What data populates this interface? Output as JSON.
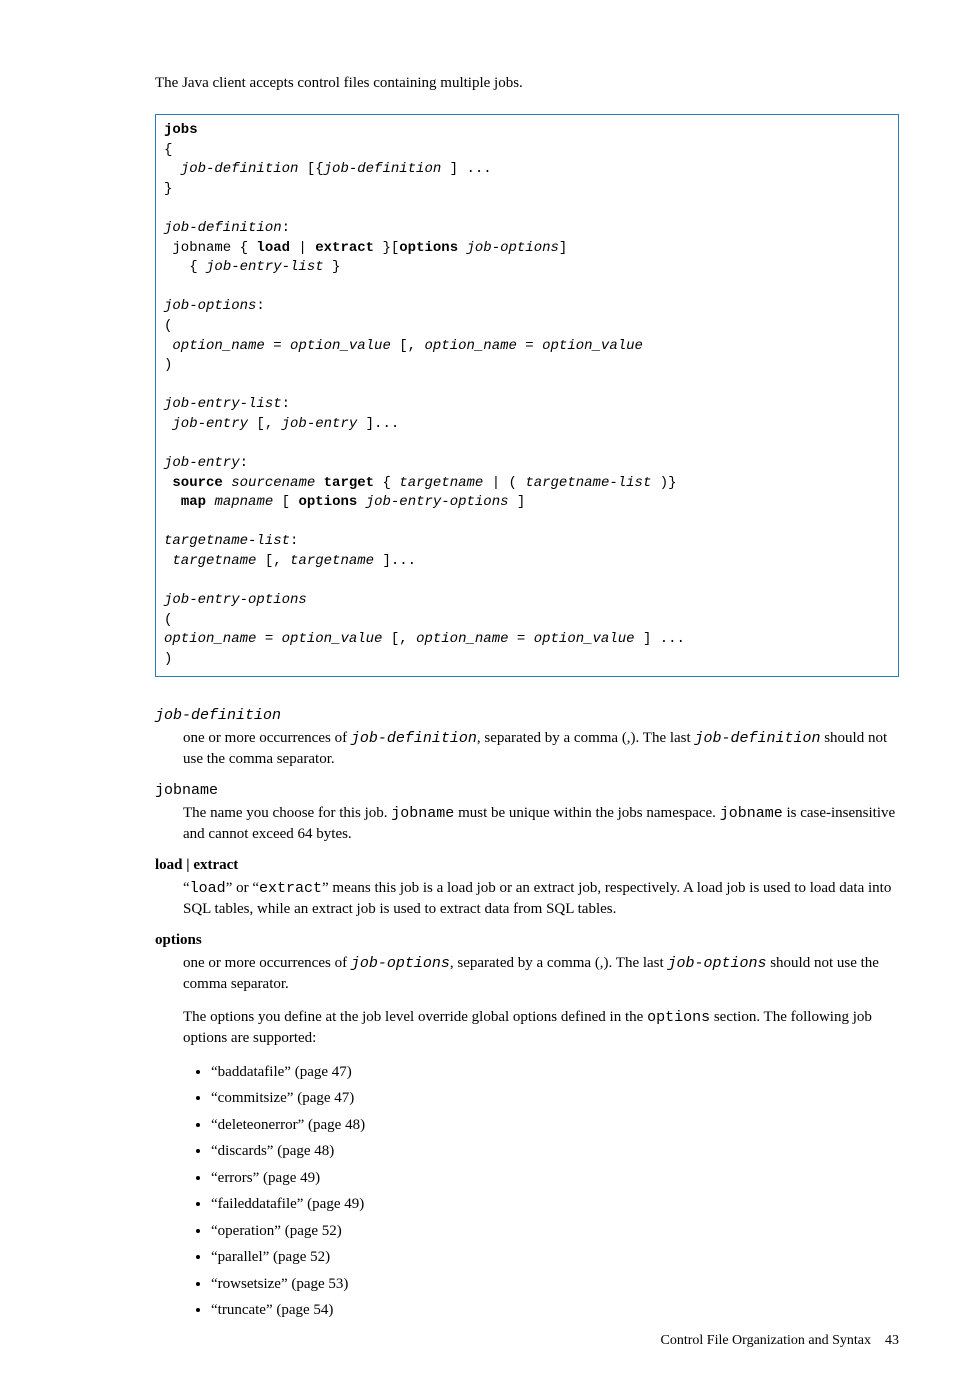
{
  "intro": "The Java client accepts control files containing multiple jobs.",
  "code": {
    "l1": "jobs",
    "l2": "{",
    "l3a": "  job-definition",
    "l3b": " [{",
    "l3c": "job-definition",
    "l3d": " ] ...",
    "l4": "}",
    "l5": "",
    "l6a": "job-definition",
    "l6b": ":",
    "l7a": " jobname { ",
    "l7b": "load",
    "l7c": " | ",
    "l7d": "extract",
    "l7e": " }[",
    "l7f": "options",
    "l7g": " ",
    "l7h": "job-options",
    "l7i": "]",
    "l8a": "   { ",
    "l8b": "job-entry-list",
    "l8c": " }",
    "l9": "",
    "l10a": "job-options",
    "l10b": ":",
    "l11": "(",
    "l12a": " option_name",
    "l12b": " = ",
    "l12c": "option_value",
    "l12d": " [, ",
    "l12e": "option_name",
    "l12f": " = ",
    "l12g": "option_value",
    "l13": ")",
    "l14": "",
    "l15a": "job-entry-list",
    "l15b": ":",
    "l16a": " job-entry",
    "l16b": " [, ",
    "l16c": "job-entry",
    "l16d": " ]...",
    "l17": "",
    "l18a": "job-entry",
    "l18b": ":",
    "l19a": " ",
    "l19b": "source",
    "l19c": " ",
    "l19d": "sourcename",
    "l19e": " ",
    "l19f": "target",
    "l19g": " { ",
    "l19h": "targetname",
    "l19i": " | ( ",
    "l19j": "targetname-list",
    "l19k": " )}",
    "l20a": "  ",
    "l20b": "map",
    "l20c": " ",
    "l20d": "mapname",
    "l20e": " [ ",
    "l20f": "options",
    "l20g": " ",
    "l20h": "job-entry-options",
    "l20i": " ]",
    "l21": "",
    "l22a": "targetname-list",
    "l22b": ":",
    "l23a": " targetname",
    "l23b": " [, ",
    "l23c": "targetname",
    "l23d": " ]...",
    "l24": "",
    "l25": "job-entry-options",
    "l26": "(",
    "l27a": "option_name",
    "l27b": " = ",
    "l27c": "option_value",
    "l27d": " [, ",
    "l27e": "option_name",
    "l27f": " = ",
    "l27g": "option_value",
    "l27h": " ] ...",
    "l28": ")"
  },
  "defs": {
    "dt1": "job-definition",
    "dd1a": "one or more occurrences of ",
    "dd1b": "job-definition",
    "dd1c": ", separated by a comma (,). The last ",
    "dd1d": "job-definition",
    "dd1e": " should not use the comma separator.",
    "dt2": "jobname",
    "dd2a": "The name you choose for this job. ",
    "dd2b": "jobname",
    "dd2c": " must be unique within the jobs namespace. ",
    "dd2d": "jobname",
    "dd2e": " is case-insensitive and cannot exceed 64 bytes.",
    "dt3": "load | extract",
    "dd3a": "“",
    "dd3b": "load",
    "dd3c": "” or “",
    "dd3d": "extract",
    "dd3e": "” means this job is a load job or an extract job, respectively. A load job is used to load data into SQL tables, while an extract job is used to extract data from SQL tables.",
    "dt4": "options",
    "dd4a": "one or more occurrences of ",
    "dd4b": "job-options",
    "dd4c": ", separated by a comma (,). The last ",
    "dd4d": "job-options",
    "dd4e": " should not use the comma separator.",
    "dd4p2a": "The options you define at the job level override global options defined in the ",
    "dd4p2b": "options",
    "dd4p2c": " section. The following job options are supported:"
  },
  "bullets": [
    "“baddatafile” (page 47)",
    "“commitsize” (page 47)",
    "“deleteonerror” (page 48)",
    "“discards” (page 48)",
    "“errors” (page 49)",
    "“faileddatafile” (page 49)",
    "“operation” (page 52)",
    "“parallel” (page 52)",
    "“rowsetsize” (page 53)",
    "“truncate” (page 54)"
  ],
  "footer_text": "Control File Organization and Syntax",
  "footer_page": "43"
}
